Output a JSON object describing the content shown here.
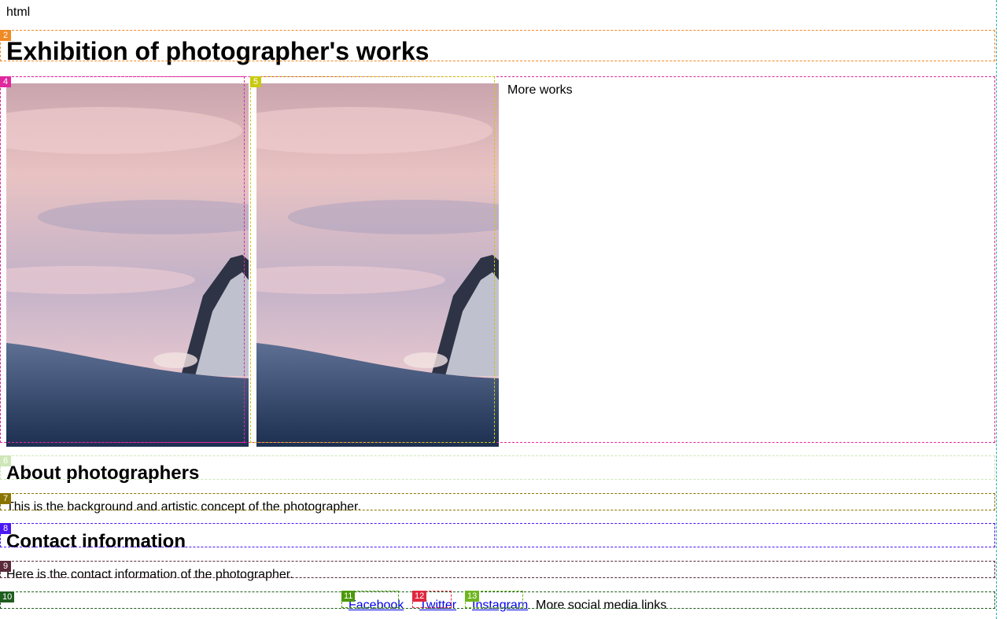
{
  "root_label": "html",
  "header": {
    "title": "Exhibition of photographer's works"
  },
  "gallery": {
    "photos": [
      {
        "name": "photo-1"
      },
      {
        "name": "photo-2"
      }
    ],
    "more_label": "More works"
  },
  "about": {
    "heading": "About photographers",
    "text": "This is the background and artistic concept of the photographer."
  },
  "contact": {
    "heading": "Contact information",
    "text": "Here is the contact information of the photographer."
  },
  "footer": {
    "links": [
      {
        "label": "Facebook"
      },
      {
        "label": "Twitter"
      },
      {
        "label": "Instagram"
      }
    ],
    "more_label": "More social media links"
  },
  "overlay_tags": {
    "header": "2",
    "gallery": "4",
    "photo_2": "5",
    "about_h": "6",
    "about_p": "7",
    "contact_h": "8",
    "contact_p": "9",
    "footer": "10",
    "facebook": "11",
    "twitter": "12",
    "instagram": "13"
  },
  "overlay_colors": {
    "outer": "#2ab3b0",
    "header": "#f08a24",
    "gallery": "#e0279e",
    "photo_2": "#c9c90f",
    "about_h": "#cfe6b8",
    "about_p": "#8a7400",
    "contact_h": "#4b17f5",
    "contact_p": "#5a2a3a",
    "footer": "#1e5e1e",
    "facebook": "#4c9a0a",
    "twitter": "#e0273d",
    "instagram": "#6fb61e"
  }
}
